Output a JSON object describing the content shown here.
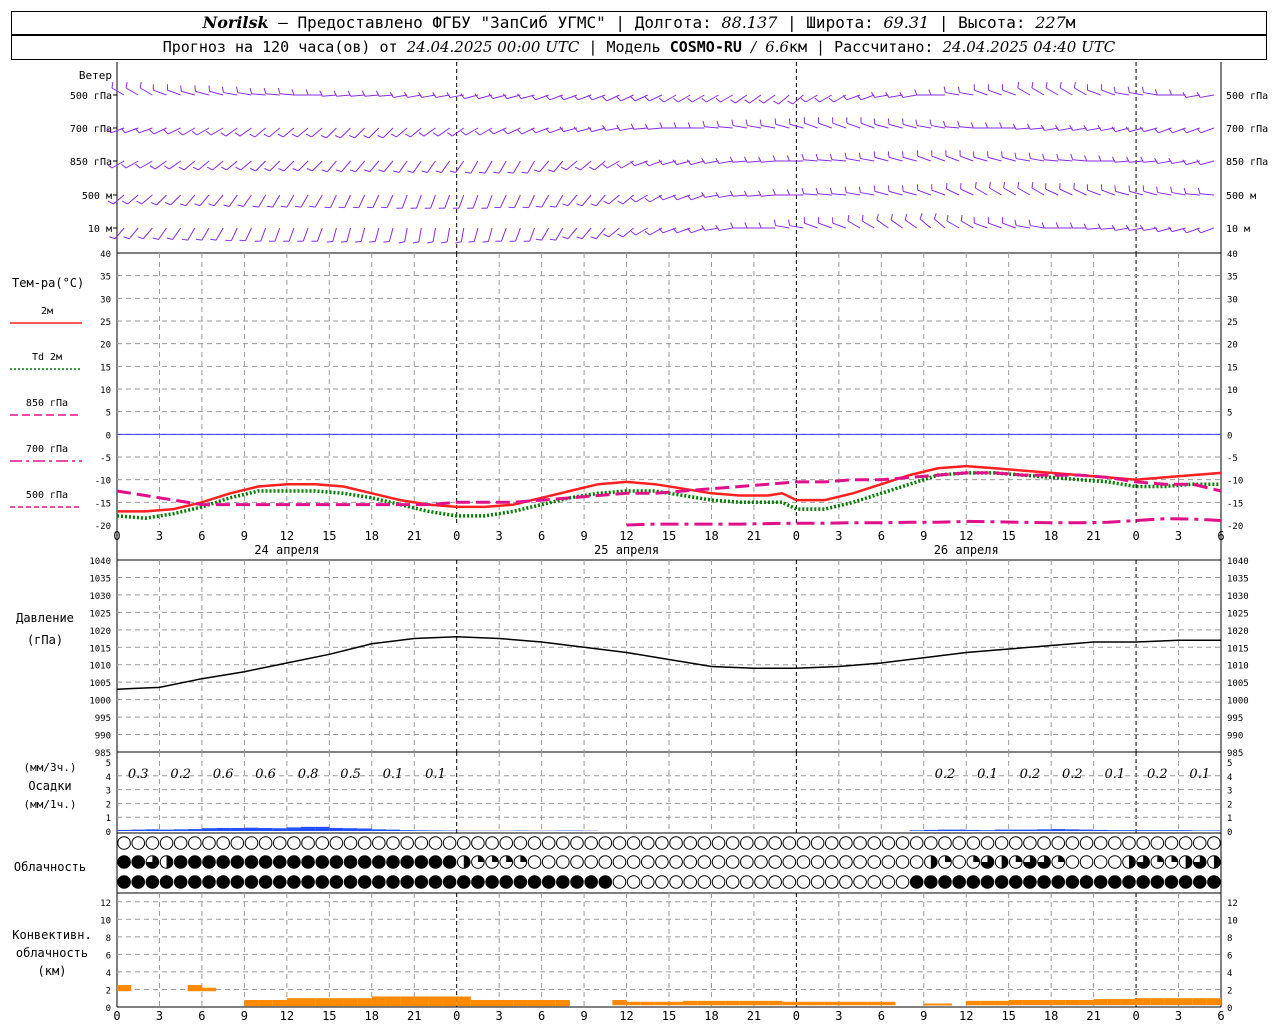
{
  "header": {
    "station": "Norilsk",
    "dash": "–",
    "provider": "Предоставлено ФГБУ \"ЗапСиб УГМС\"",
    "lon_label": "Долгота:",
    "lon_value": "88.137",
    "lat_label": "Широта:",
    "lat_value": "69.31",
    "alt_label": "Высота:",
    "alt_value": "227",
    "alt_unit": "м",
    "sep": "|",
    "forecast_prefix": "Прогноз на 120 часа(ов) от",
    "forecast_time": "24.04.2025 00:00 UTC",
    "model_label": "Модель",
    "model_name": "COSMO-RU",
    "model_res_sep": "/",
    "model_res": "6.6",
    "model_res_unit": "км",
    "calc_label": "Рассчитано:",
    "calc_time": "24.04.2025 04:40 UTC"
  },
  "colors": {
    "wind": "#8a2be2",
    "t2m": "#ff2020",
    "td2m": "#007a00",
    "t850": "#e0108a",
    "t700": "#e0108a",
    "t500": "#e0108a",
    "zero_line": "#3a3aff",
    "pressure": "#000000",
    "precip": "#2050ff",
    "convective": "#ff8a00",
    "grid": "#9a9a9a"
  },
  "x_axis": {
    "tick_labels": [
      "0",
      "3",
      "6",
      "9",
      "12",
      "15",
      "18",
      "21",
      "0",
      "3",
      "6",
      "9",
      "12",
      "15",
      "18",
      "21",
      "0",
      "3",
      "6",
      "9",
      "12",
      "15",
      "18",
      "21",
      "0",
      "3",
      "6"
    ],
    "day_labels": [
      {
        "hour": 12,
        "text": "24 апреля"
      },
      {
        "hour": 36,
        "text": "25 апреля"
      },
      {
        "hour": 60,
        "text": "26 апреля"
      }
    ]
  },
  "wind_panel": {
    "title": "Ветер",
    "levels": [
      "500 гПа",
      "700 гПа",
      "850 гПа",
      "500 м",
      "10  м"
    ]
  },
  "chart_data": [
    {
      "type": "line",
      "id": "temperature",
      "ylabel": "Тем-ра(°C)",
      "ylim": [
        -20,
        40
      ],
      "yticks": [
        -20,
        -15,
        -10,
        -5,
        0,
        5,
        10,
        15,
        20,
        25,
        30,
        35,
        40
      ],
      "x_unit_hours": [
        0,
        78
      ],
      "series": [
        {
          "name": "2м",
          "style": "solid",
          "x": [
            0,
            2,
            4,
            6,
            8,
            10,
            12,
            14,
            16,
            18,
            20,
            22,
            24,
            26,
            28,
            30,
            32,
            34,
            36,
            38,
            40,
            42,
            44,
            46,
            47,
            48,
            50,
            52,
            54,
            56,
            58,
            60,
            62,
            64,
            66,
            68,
            70,
            72,
            74,
            76,
            78
          ],
          "values": [
            -17,
            -17,
            -16.5,
            -15,
            -13,
            -11.5,
            -11,
            -11,
            -11.5,
            -13,
            -14.5,
            -15.5,
            -16,
            -16,
            -15.5,
            -14,
            -12.5,
            -11,
            -10.5,
            -11,
            -12,
            -13,
            -13.5,
            -13.5,
            -13,
            -14.5,
            -14.5,
            -13,
            -11,
            -9,
            -7.5,
            -7,
            -7.5,
            -8,
            -8.5,
            -9,
            -9.5,
            -10,
            -9.5,
            -9,
            -8.5
          ]
        },
        {
          "name": "Td 2м",
          "style": "dotted",
          "x": [
            0,
            2,
            4,
            6,
            8,
            10,
            12,
            14,
            16,
            18,
            20,
            22,
            24,
            26,
            28,
            30,
            32,
            34,
            36,
            38,
            40,
            42,
            44,
            46,
            47,
            48,
            50,
            52,
            54,
            56,
            58,
            60,
            62,
            64,
            66,
            68,
            70,
            72,
            74,
            76,
            78
          ],
          "values": [
            -18,
            -18.5,
            -17.5,
            -16,
            -14,
            -12.5,
            -12.5,
            -12.5,
            -13,
            -14,
            -15.5,
            -17,
            -18,
            -18,
            -17,
            -15.5,
            -14,
            -13,
            -12.5,
            -12.5,
            -13.5,
            -14.5,
            -15,
            -15,
            -15,
            -16.5,
            -16.5,
            -15,
            -13,
            -11,
            -9,
            -8.5,
            -8.5,
            -9,
            -9.5,
            -10,
            -10.5,
            -11.5,
            -11.5,
            -11,
            -11
          ]
        },
        {
          "name": "850 гПа",
          "style": "dashed",
          "x": [
            0,
            2,
            4,
            6,
            8,
            10,
            12,
            14,
            16,
            18,
            20,
            22,
            24,
            26,
            28,
            30,
            32,
            34,
            36,
            38,
            40,
            42,
            44,
            46,
            48,
            50,
            52,
            54,
            56,
            58,
            60,
            62,
            64,
            66,
            68,
            70,
            72,
            74,
            76,
            78
          ],
          "values": [
            -12.5,
            -13.5,
            -14.5,
            -15.5,
            -15.5,
            -15.5,
            -15.5,
            -15.5,
            -15.5,
            -15.5,
            -15.5,
            -15.5,
            -15,
            -15,
            -15,
            -14.5,
            -14,
            -13.5,
            -13,
            -13,
            -12.5,
            -12,
            -11.5,
            -11,
            -10.5,
            -10.5,
            -10,
            -10,
            -9.5,
            -9,
            -8.5,
            -8.5,
            -9,
            -9,
            -9,
            -9.5,
            -10.5,
            -11,
            -11,
            -12.5
          ]
        },
        {
          "name": "700 гПа",
          "style": "dashdot",
          "x": [
            36,
            38,
            40,
            42,
            44,
            46,
            48,
            50,
            52,
            54,
            56,
            58,
            60,
            62,
            64,
            66,
            68,
            70,
            72,
            74,
            76,
            78
          ],
          "values": [
            -20,
            -19.8,
            -19.8,
            -19.8,
            -19.8,
            -19.7,
            -19.6,
            -19.6,
            -19.5,
            -19.5,
            -19.4,
            -19.4,
            -19.2,
            -19.3,
            -19.4,
            -19.5,
            -19.5,
            -19.4,
            -19,
            -18.6,
            -18.7,
            -19
          ]
        },
        {
          "name": "500 гПа",
          "style": "longdash",
          "x": [],
          "values": []
        }
      ]
    },
    {
      "type": "line",
      "id": "pressure",
      "ylabel": "Давление",
      "yunit": "(гПа)",
      "ylim": [
        985,
        1040
      ],
      "yticks": [
        985,
        990,
        995,
        1000,
        1005,
        1010,
        1015,
        1020,
        1025,
        1030,
        1035,
        1040
      ],
      "series": [
        {
          "name": "pressure",
          "x": [
            0,
            3,
            6,
            9,
            12,
            15,
            18,
            21,
            24,
            27,
            30,
            33,
            36,
            39,
            42,
            45,
            48,
            51,
            54,
            57,
            60,
            63,
            66,
            69,
            72,
            75,
            78
          ],
          "values": [
            1003,
            1003.5,
            1006,
            1008,
            1010.5,
            1013,
            1016,
            1017.5,
            1018,
            1017.5,
            1016.5,
            1015,
            1013.5,
            1011.5,
            1009.5,
            1009,
            1009,
            1009.5,
            1010.5,
            1012,
            1013.5,
            1014.5,
            1015.5,
            1016.5,
            1016.5,
            1017,
            1017
          ]
        }
      ]
    },
    {
      "type": "bar",
      "id": "precipitation",
      "ylabel": "Осадки",
      "yunit_top": "(мм/3ч.)",
      "yunit_bottom": "(мм/1ч.)",
      "ylim": [
        0,
        5
      ],
      "yticks": [
        0,
        1,
        2,
        3,
        4,
        5
      ],
      "totals_3h": [
        {
          "hour": 1.5,
          "text": "0.3"
        },
        {
          "hour": 4.5,
          "text": "0.2"
        },
        {
          "hour": 7.5,
          "text": "0.6"
        },
        {
          "hour": 10.5,
          "text": "0.6"
        },
        {
          "hour": 13.5,
          "text": "0.8"
        },
        {
          "hour": 16.5,
          "text": "0.5"
        },
        {
          "hour": 19.5,
          "text": "0.1"
        },
        {
          "hour": 22.5,
          "text": "0.1"
        },
        {
          "hour": 58.5,
          "text": "0.2"
        },
        {
          "hour": 61.5,
          "text": "0.1"
        },
        {
          "hour": 64.5,
          "text": "0.2"
        },
        {
          "hour": 67.5,
          "text": "0.2"
        },
        {
          "hour": 70.5,
          "text": "0.1"
        },
        {
          "hour": 73.5,
          "text": "0.2"
        },
        {
          "hour": 76.5,
          "text": "0.1"
        }
      ],
      "hourly": [
        0.08,
        0.1,
        0.12,
        0.1,
        0.12,
        0.14,
        0.2,
        0.22,
        0.22,
        0.24,
        0.22,
        0.2,
        0.26,
        0.3,
        0.3,
        0.22,
        0.2,
        0.18,
        0.12,
        0.1,
        0.06,
        0.05,
        0.04,
        0.03,
        0.02,
        0.02,
        0.02,
        0.02,
        0.03,
        0.02,
        0.02,
        0.03,
        0.03,
        0.02,
        0,
        0,
        0,
        0,
        0,
        0,
        0,
        0,
        0,
        0,
        0,
        0,
        0,
        0,
        0,
        0,
        0,
        0,
        0,
        0,
        0,
        0,
        0.05,
        0.08,
        0.1,
        0.1,
        0.08,
        0.06,
        0.1,
        0.1,
        0.1,
        0.12,
        0.14,
        0.12,
        0.1,
        0.08,
        0.06,
        0.06,
        0.06,
        0.06,
        0.06,
        0.06,
        0.04,
        0.04
      ]
    },
    {
      "type": "table",
      "id": "cloudiness",
      "ylabel": "Облачность",
      "note": "cloud cover fraction per hour (0..1), rows: high, middle, low",
      "rows": {
        "high": [
          0,
          0,
          0,
          0,
          0,
          0,
          0,
          0,
          0,
          0,
          0,
          0,
          0,
          0,
          0,
          0,
          0,
          0,
          0,
          0,
          0,
          0,
          0,
          0,
          0,
          0,
          0,
          0,
          0,
          0,
          0,
          0,
          0,
          0,
          0,
          0,
          0,
          0,
          0,
          0,
          0,
          0,
          0,
          0,
          0,
          0,
          0,
          0,
          0,
          0,
          0,
          0,
          0,
          0,
          0,
          0,
          0,
          0,
          0,
          0,
          0,
          0,
          0,
          0,
          0,
          0,
          0,
          0,
          0,
          0,
          0,
          0,
          0,
          0,
          0,
          0,
          0,
          0
        ],
        "middle": [
          1,
          1,
          0.75,
          0.5,
          1,
          1,
          1,
          1,
          1,
          1,
          1,
          1,
          1,
          1,
          1,
          1,
          1,
          1,
          1,
          1,
          1,
          1,
          1,
          1,
          0.5,
          0.25,
          0.25,
          0.25,
          0.25,
          0,
          0,
          0,
          0,
          0,
          0,
          0,
          0,
          0,
          0,
          0,
          0,
          0,
          0,
          0,
          0,
          0,
          0,
          0,
          0,
          0,
          0,
          0,
          0,
          0,
          0,
          0,
          0,
          0.5,
          0.25,
          0,
          0.25,
          0.75,
          0.5,
          0.25,
          0.75,
          0.75,
          0.25,
          0,
          0,
          0,
          0,
          0.5,
          0.75,
          0.25,
          0.25,
          0.5,
          0.75,
          0.5
        ],
        "low": [
          1,
          1,
          1,
          1,
          1,
          1,
          1,
          1,
          1,
          1,
          1,
          1,
          1,
          1,
          1,
          1,
          1,
          1,
          1,
          1,
          1,
          1,
          1,
          1,
          1,
          1,
          1,
          1,
          1,
          1,
          1,
          1,
          1,
          1,
          1,
          0,
          0,
          0,
          0,
          0,
          0,
          0,
          0,
          0,
          0,
          0,
          0,
          0,
          0,
          0,
          0,
          0,
          0,
          0,
          0,
          0,
          1,
          1,
          1,
          1,
          1,
          1,
          1,
          1,
          1,
          1,
          1,
          1,
          1,
          1,
          1,
          1,
          1,
          1,
          1,
          1,
          1,
          1
        ]
      }
    },
    {
      "type": "bar",
      "id": "convective_cloudiness",
      "ylabel_lines": [
        "Конвективн.",
        "облачность",
        "(км)"
      ],
      "ylim": [
        0,
        13
      ],
      "yticks": [
        0,
        2,
        4,
        6,
        8,
        10,
        12
      ],
      "hourly_top_km": [
        2.5,
        0,
        0,
        0,
        0,
        2.5,
        2.2,
        0,
        0,
        0.8,
        0.8,
        0.8,
        1.0,
        1.0,
        1.0,
        1.0,
        1.0,
        1.0,
        1.2,
        1.2,
        1.2,
        1.2,
        1.2,
        1.2,
        1.2,
        0.8,
        0.8,
        0.8,
        0.8,
        0.8,
        0.8,
        0.8,
        0,
        0,
        0,
        0.8,
        0.6,
        0.6,
        0.6,
        0.6,
        0.7,
        0.7,
        0.7,
        0.7,
        0.7,
        0.7,
        0.7,
        0.6,
        0.6,
        0.6,
        0.6,
        0.6,
        0.6,
        0.6,
        0.6,
        0,
        0,
        0.4,
        0.4,
        0,
        0.7,
        0.7,
        0.7,
        0.8,
        0.8,
        0.8,
        0.8,
        0.8,
        0.8,
        0.9,
        0.9,
        0.9,
        1.0,
        1.0,
        1.0,
        1.0,
        1.0,
        1.0
      ],
      "hourly_base_km": [
        1.8,
        0,
        0,
        0,
        0,
        1.8,
        1.8,
        0,
        0,
        0.1,
        0.1,
        0.1,
        0.1,
        0.1,
        0.1,
        0.1,
        0.1,
        0.1,
        0.1,
        0.1,
        0.1,
        0.1,
        0.1,
        0.1,
        0.1,
        0.1,
        0.1,
        0.1,
        0.1,
        0.1,
        0.1,
        0.1,
        0,
        0,
        0,
        0.2,
        0.2,
        0.2,
        0.2,
        0.2,
        0.2,
        0.2,
        0.2,
        0.2,
        0.2,
        0.2,
        0.2,
        0.2,
        0.2,
        0.2,
        0.2,
        0.2,
        0.2,
        0.2,
        0.2,
        0,
        0,
        0.2,
        0.2,
        0,
        0.2,
        0.2,
        0.2,
        0.2,
        0.2,
        0.2,
        0.2,
        0.2,
        0.2,
        0.2,
        0.2,
        0.2,
        0.2,
        0.2,
        0.2,
        0.2,
        0.2,
        0.2
      ]
    }
  ]
}
